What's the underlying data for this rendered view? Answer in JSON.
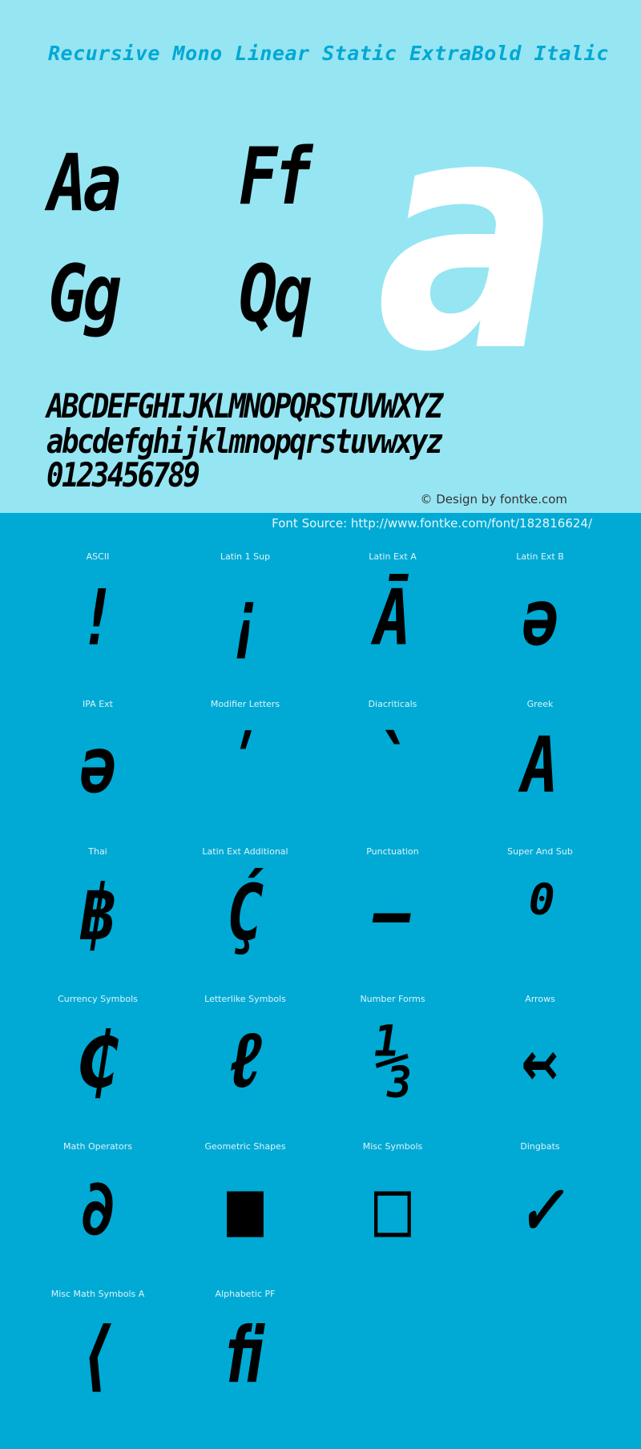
{
  "header": {
    "title": "Recursive Mono Linear Static ExtraBold Italic"
  },
  "specimen": {
    "pairs": [
      "Aa",
      "Ff",
      "Gg",
      "Qq"
    ],
    "hero_glyph": "a",
    "uppercase": "ABCDEFGHIJKLMNOPQRSTUVWXYZ",
    "lowercase": "abcdefghijklmnopqrstuvwxyz",
    "digits": "0123456789",
    "credit": "© Design by fontke.com"
  },
  "source": {
    "text": "Font Source: http://www.fontke.com/font/182816624/"
  },
  "colors": {
    "top_background": "#96E5F2",
    "bottom_background": "#00AAD5",
    "title": "#00A8D4",
    "hero_glyph": "#FFFFFF",
    "glyph": "#000000"
  },
  "blocks": [
    {
      "label": "ASCII",
      "glyph": "!"
    },
    {
      "label": "Latin 1 Sup",
      "glyph": "¡"
    },
    {
      "label": "Latin Ext A",
      "glyph": "Ā"
    },
    {
      "label": "Latin Ext B",
      "glyph": "ə"
    },
    {
      "label": "IPA Ext",
      "glyph": "ə"
    },
    {
      "label": "Modifier Letters",
      "glyph": "ʹ"
    },
    {
      "label": "Diacriticals",
      "glyph": "`"
    },
    {
      "label": "Greek",
      "glyph": "Α"
    },
    {
      "label": "Thai",
      "glyph": "฿"
    },
    {
      "label": "Latin Ext Additional",
      "glyph": "Ḉ"
    },
    {
      "label": "Punctuation",
      "glyph": "‒"
    },
    {
      "label": "Super And Sub",
      "glyph": "⁰"
    },
    {
      "label": "Currency Symbols",
      "glyph": "₵"
    },
    {
      "label": "Letterlike Symbols",
      "glyph": "ℓ"
    },
    {
      "label": "Number Forms",
      "glyph": "⅓"
    },
    {
      "label": "Arrows",
      "glyph": "↢"
    },
    {
      "label": "Math Operators",
      "glyph": "∂"
    },
    {
      "label": "Geometric Shapes",
      "glyph": "■"
    },
    {
      "label": "Misc Symbols",
      "glyph": "□"
    },
    {
      "label": "Dingbats",
      "glyph": "✓"
    },
    {
      "label": "Misc Math Symbols A",
      "glyph": "⟨"
    },
    {
      "label": "Alphabetic PF",
      "glyph": "ﬁ"
    }
  ]
}
